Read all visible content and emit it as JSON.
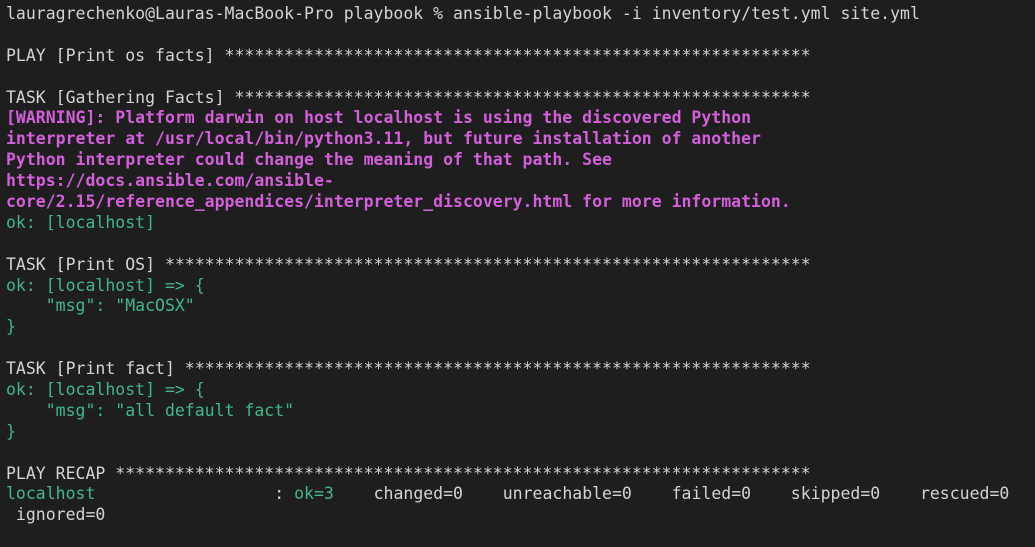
{
  "colors": {
    "background": "#1e1e1e",
    "text": "#d4d4d4",
    "warning": "#d45fdb",
    "ok": "#3fb98a"
  },
  "terminal": {
    "lines": [
      {
        "type": "command",
        "segments": [
          {
            "text": "lauragrechenko@Lauras-MacBook-Pro playbook % ansible-playbook -i inventory/test.yml site.yml",
            "style": "plain"
          }
        ]
      },
      {
        "type": "blank",
        "segments": []
      },
      {
        "type": "play-header",
        "segments": [
          {
            "text": "PLAY [Print os facts] ***********************************************************",
            "style": "plain"
          }
        ]
      },
      {
        "type": "blank",
        "segments": []
      },
      {
        "type": "task-header",
        "segments": [
          {
            "text": "TASK [Gathering Facts] **********************************************************",
            "style": "plain"
          }
        ]
      },
      {
        "type": "warning",
        "segments": [
          {
            "text": "[WARNING]: Platform darwin on host localhost is using the discovered Python",
            "style": "warn"
          }
        ]
      },
      {
        "type": "warning",
        "segments": [
          {
            "text": "interpreter at /usr/local/bin/python3.11, but future installation of another",
            "style": "warn"
          }
        ]
      },
      {
        "type": "warning",
        "segments": [
          {
            "text": "Python interpreter could change the meaning of that path. See",
            "style": "warn"
          }
        ]
      },
      {
        "type": "warning",
        "segments": [
          {
            "text": "https://docs.ansible.com/ansible-",
            "style": "warn"
          }
        ]
      },
      {
        "type": "warning",
        "segments": [
          {
            "text": "core/2.15/reference_appendices/interpreter_discovery.html for more information.",
            "style": "warn"
          }
        ]
      },
      {
        "type": "result",
        "segments": [
          {
            "text": "ok: [localhost]",
            "style": "ok"
          }
        ]
      },
      {
        "type": "blank",
        "segments": []
      },
      {
        "type": "task-header",
        "segments": [
          {
            "text": "TASK [Print OS] *****************************************************************",
            "style": "plain"
          }
        ]
      },
      {
        "type": "result",
        "segments": [
          {
            "text": "ok: [localhost] => {",
            "style": "ok"
          }
        ]
      },
      {
        "type": "result",
        "segments": [
          {
            "text": "    \"msg\": \"MacOSX\"",
            "style": "ok"
          }
        ]
      },
      {
        "type": "result",
        "segments": [
          {
            "text": "}",
            "style": "ok"
          }
        ]
      },
      {
        "type": "blank",
        "segments": []
      },
      {
        "type": "task-header",
        "segments": [
          {
            "text": "TASK [Print fact] ***************************************************************",
            "style": "plain"
          }
        ]
      },
      {
        "type": "result",
        "segments": [
          {
            "text": "ok: [localhost] => {",
            "style": "ok"
          }
        ]
      },
      {
        "type": "result",
        "segments": [
          {
            "text": "    \"msg\": \"all default fact\"",
            "style": "ok"
          }
        ]
      },
      {
        "type": "result",
        "segments": [
          {
            "text": "}",
            "style": "ok"
          }
        ]
      },
      {
        "type": "blank",
        "segments": []
      },
      {
        "type": "recap-header",
        "segments": [
          {
            "text": "PLAY RECAP **********************************************************************",
            "style": "plain"
          }
        ]
      },
      {
        "type": "recap",
        "segments": [
          {
            "text": "localhost",
            "style": "ok"
          },
          {
            "text": "                  : ",
            "style": "plain"
          },
          {
            "text": "ok=3",
            "style": "ok"
          },
          {
            "text": "    changed=0    unreachable=0    failed=0    skipped=0    rescued=0",
            "style": "plain"
          }
        ]
      },
      {
        "type": "recap",
        "segments": [
          {
            "text": " ignored=0",
            "style": "plain"
          }
        ]
      }
    ]
  }
}
